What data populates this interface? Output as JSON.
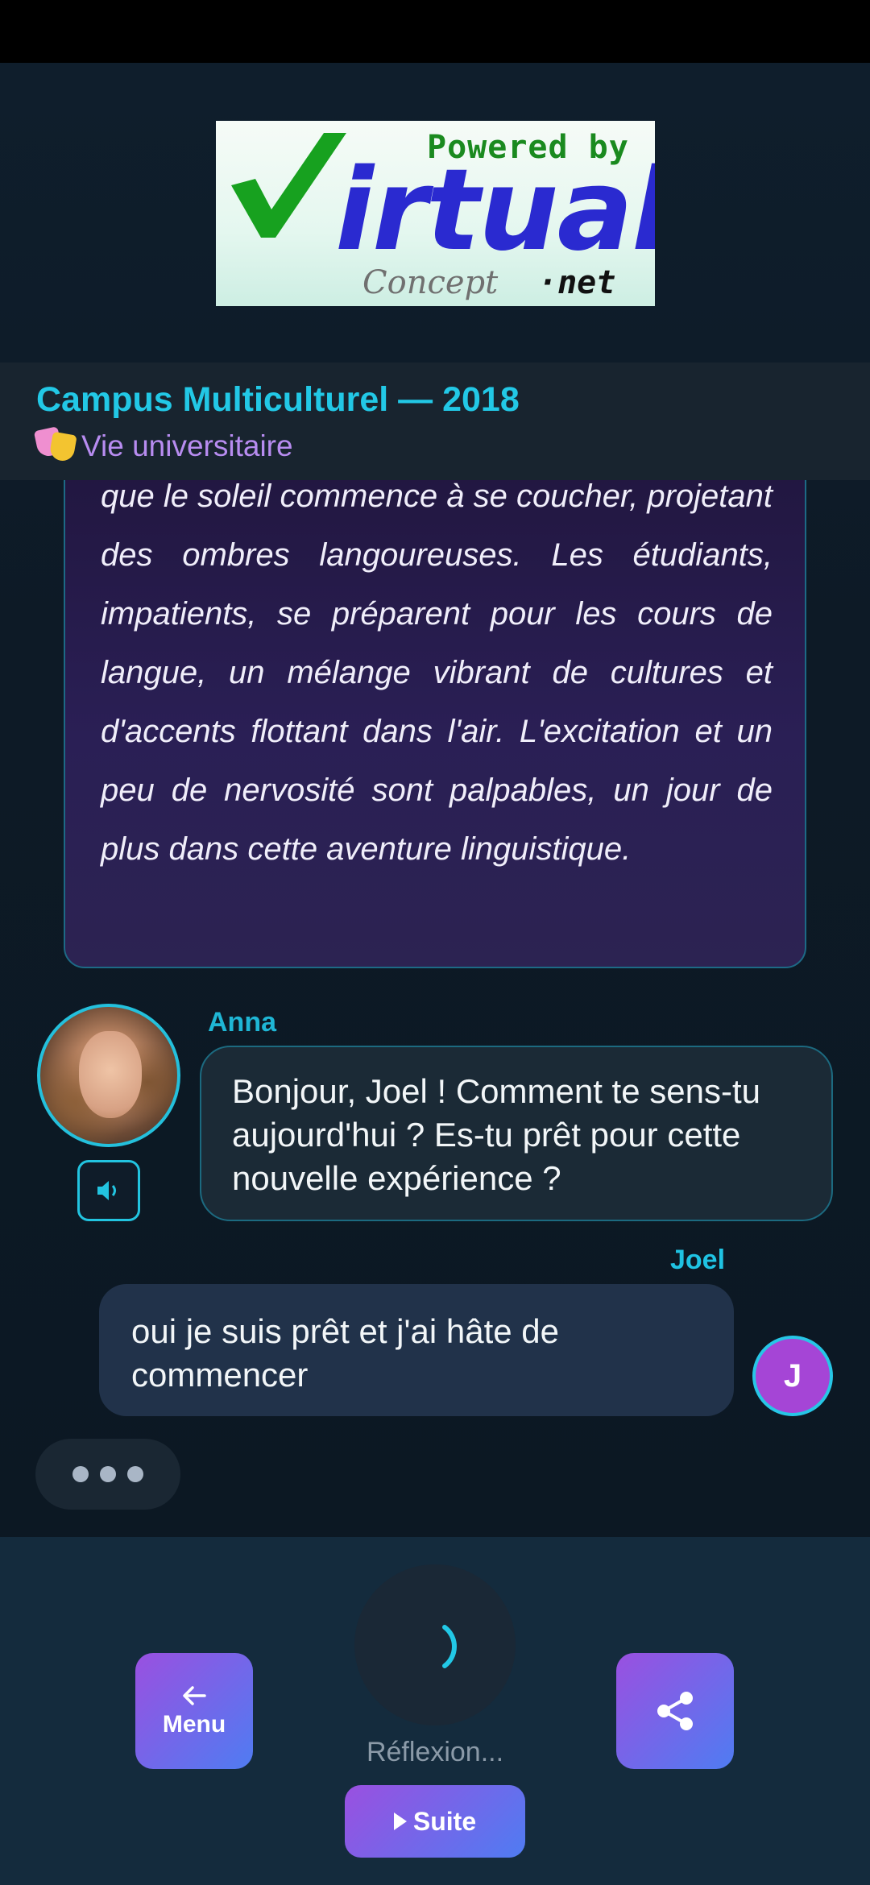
{
  "logo": {
    "powered_by": "Powered by",
    "brand_main": "irtual",
    "brand_concept": "Concept",
    "brand_net": "·net"
  },
  "header": {
    "title": "Campus Multiculturel — 2018",
    "subtitle": "Vie universitaire"
  },
  "narration": {
    "text": "que le soleil commence à se coucher, projetant des ombres langoureuses. Les étudiants, impatients, se préparent pour les cours de langue, un mélange vibrant de cultures et d'accents flottant dans l'air. L'excitation et un peu de nervosité sont palpables, un jour de plus dans cette aventure linguistique."
  },
  "messages": [
    {
      "sender": "Anna",
      "text": "Bonjour, Joel ! Comment te sens-tu aujourd'hui ? Es-tu prêt pour cette nouvelle expérience ?"
    },
    {
      "sender": "Joel",
      "avatar_initial": "J",
      "text": "oui je suis prêt et j'ai hâte de commencer"
    }
  ],
  "bottom": {
    "menu_label": "Menu",
    "thinking_label": "Réflexion...",
    "next_label": "Suite"
  },
  "colors": {
    "accent_cyan": "#22c8e6",
    "accent_purple": "#9a50e0",
    "accent_blue": "#4f7cf2",
    "background": "#0e1b27"
  },
  "icons": {
    "audio": "speaker-icon",
    "menu": "arrow-left-icon",
    "share": "share-icon",
    "next": "play-icon",
    "loading": "spinner-icon"
  }
}
